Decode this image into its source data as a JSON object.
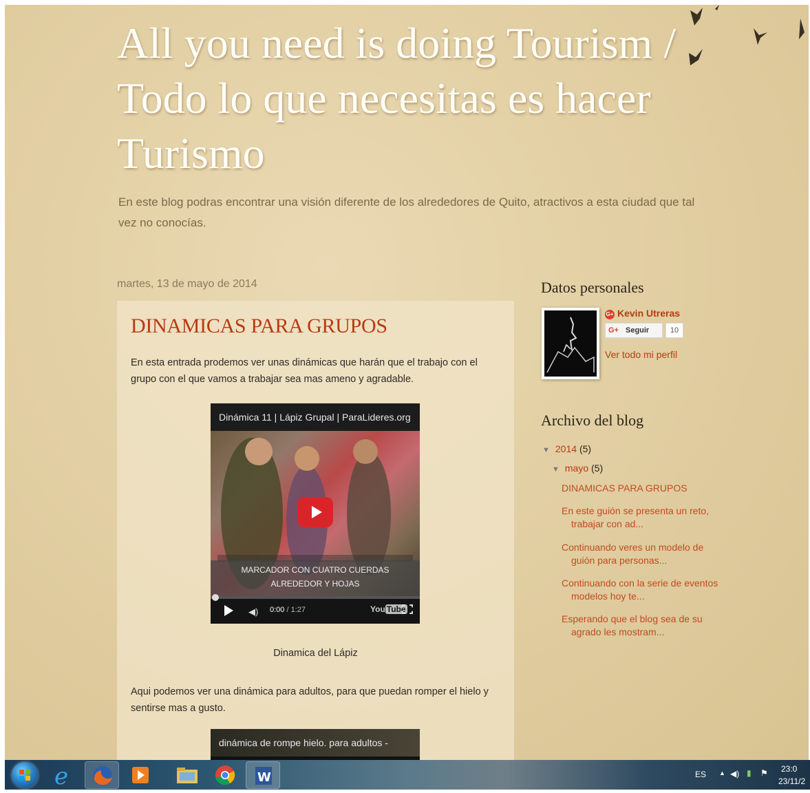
{
  "blog": {
    "title": "All you need is doing Tourism / Todo lo que necesitas es hacer Turismo",
    "description": "En este blog podras encontrar una visión diferente de los alrededores de Quito, atractivos a esta ciudad que tal vez no conocías."
  },
  "post": {
    "date": "martes, 13 de mayo de 2014",
    "title": "DINAMICAS PARA GRUPOS",
    "intro": "En esta entrada prodemos ver unas dinámicas que harán que el trabajo con el grupo con el que vamos a trabajar sea mas ameno y agradable.",
    "video1": {
      "title": "Dinámica 11 | Lápiz Grupal | ParaLideres.org",
      "overlay_line1": "MARCADOR CON CUATRO CUERDAS",
      "overlay_line2": "ALREDEDOR Y HOJAS",
      "time_current": "0:00",
      "time_total": "/ 1:27",
      "caption": "Dinamica del Lápiz",
      "yt_you": "You",
      "yt_tube": "Tube",
      "progress": 0
    },
    "paragraph2": "Aqui podemos ver una dinámica para adultos, para que puedan romper el hielo y sentirse mas a gusto.",
    "video2": {
      "title": "dinámica de rompe hielo. para adultos -MANZANA"
    }
  },
  "sidebar": {
    "profile": {
      "heading": "Datos personales",
      "name": "Kevin Utreras",
      "follow_label": "Seguir",
      "follow_g": "G+",
      "follow_count": "10",
      "view_profile": "Ver todo mi perfil"
    },
    "archive": {
      "heading": "Archivo del blog",
      "year": "2014",
      "year_count": "(5)",
      "month": "mayo",
      "month_count": "(5)",
      "posts": [
        "DINAMICAS PARA GRUPOS",
        "En este guión se presenta un reto, trabajar con ad...",
        "Continuando veres un modelo de guión para personas...",
        "Continuando con la serie de eventos modelos hoy te...",
        "Esperando que el blog sea de su agrado les mostram..."
      ]
    }
  },
  "taskbar": {
    "language": "ES",
    "time": "23:0",
    "date": "23/11/2"
  },
  "colors": {
    "link": "#b83a12",
    "background": "#e2cfa3",
    "post_background": "#f0e4c8"
  }
}
